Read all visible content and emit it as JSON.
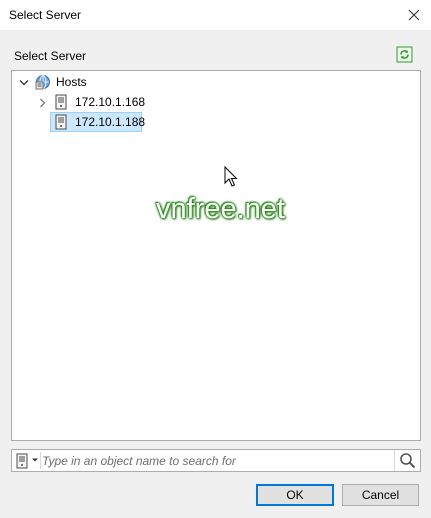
{
  "window": {
    "title": "Select Server"
  },
  "section": {
    "label": "Select Server"
  },
  "tree": {
    "root": {
      "label": "Hosts",
      "icon": "hosts-icon",
      "expanded": true
    },
    "children": [
      {
        "label": "172.10.1.168",
        "icon": "server-icon",
        "expandable": true,
        "selected": false
      },
      {
        "label": "172.10.1.188",
        "icon": "server-icon",
        "expandable": false,
        "selected": true
      }
    ]
  },
  "watermark": {
    "text": "vnfree.net"
  },
  "search": {
    "placeholder": "Type in an object name to search for",
    "value": ""
  },
  "buttons": {
    "ok_label": "OK",
    "cancel_label": "Cancel"
  },
  "colors": {
    "selection_bg": "#cce8ff",
    "selection_border": "#99d1ff",
    "default_button_border": "#0078d7",
    "watermark_glow": "#2a8a1a"
  }
}
